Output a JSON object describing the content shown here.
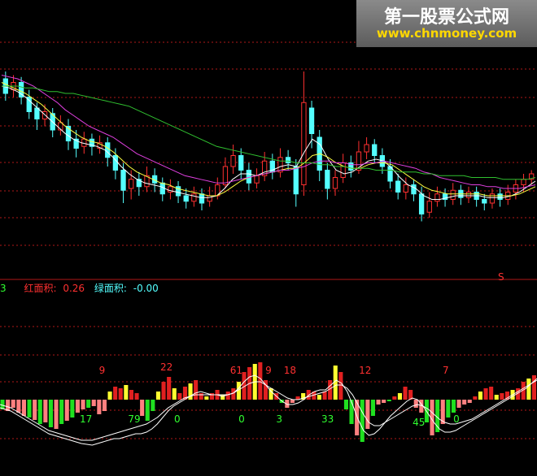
{
  "watermark": {
    "title": "第一股票公式网",
    "url": "www.chnmoney.com"
  },
  "indicator": {
    "prefix": "3",
    "red_label": "红面积:",
    "red_value": "0.26",
    "green_label": "绿面积:",
    "green_value": "-0.00"
  },
  "colors": {
    "background": "#000000",
    "grid": "#b01818",
    "up": "#ff3030",
    "down": "#54ffff",
    "ma_white": "#ffffff",
    "ma_yellow": "#ffff40",
    "ma_magenta": "#e040e0",
    "ma_green": "#30c030",
    "bar_red": "#e02020",
    "bar_yellow": "#ffff30",
    "bar_pink": "#ff8080",
    "bar_green": "#20e020",
    "label_red": "#ff3030",
    "label_green": "#30ff30"
  },
  "chart_data": [
    {
      "type": "candlestick",
      "title": "",
      "xlabel": "",
      "ylabel": "",
      "grid": true,
      "ylim": [
        0,
        100
      ],
      "marker_label": "S",
      "candles": [
        {
          "o": 88,
          "c": 80,
          "h": 92,
          "l": 76
        },
        {
          "o": 82,
          "c": 86,
          "h": 90,
          "l": 78
        },
        {
          "o": 86,
          "c": 78,
          "h": 89,
          "l": 74
        },
        {
          "o": 78,
          "c": 70,
          "h": 82,
          "l": 66
        },
        {
          "o": 72,
          "c": 66,
          "h": 75,
          "l": 60
        },
        {
          "o": 66,
          "c": 70,
          "h": 74,
          "l": 62
        },
        {
          "o": 69,
          "c": 60,
          "h": 72,
          "l": 56
        },
        {
          "o": 60,
          "c": 64,
          "h": 68,
          "l": 57
        },
        {
          "o": 62,
          "c": 54,
          "h": 66,
          "l": 49
        },
        {
          "o": 55,
          "c": 50,
          "h": 60,
          "l": 45
        },
        {
          "o": 51,
          "c": 55,
          "h": 59,
          "l": 47
        },
        {
          "o": 55,
          "c": 51,
          "h": 58,
          "l": 46
        },
        {
          "o": 50,
          "c": 53,
          "h": 57,
          "l": 47
        },
        {
          "o": 53,
          "c": 45,
          "h": 56,
          "l": 40
        },
        {
          "o": 46,
          "c": 38,
          "h": 50,
          "l": 33
        },
        {
          "o": 38,
          "c": 27,
          "h": 42,
          "l": 20
        },
        {
          "o": 28,
          "c": 33,
          "h": 38,
          "l": 22
        },
        {
          "o": 33,
          "c": 29,
          "h": 37,
          "l": 24
        },
        {
          "o": 29,
          "c": 35,
          "h": 40,
          "l": 26
        },
        {
          "o": 35,
          "c": 31,
          "h": 39,
          "l": 26
        },
        {
          "o": 31,
          "c": 25,
          "h": 34,
          "l": 21
        },
        {
          "o": 26,
          "c": 29,
          "h": 33,
          "l": 22
        },
        {
          "o": 29,
          "c": 24,
          "h": 32,
          "l": 20
        },
        {
          "o": 24,
          "c": 21,
          "h": 28,
          "l": 17
        },
        {
          "o": 21,
          "c": 25,
          "h": 29,
          "l": 18
        },
        {
          "o": 25,
          "c": 20,
          "h": 28,
          "l": 16
        },
        {
          "o": 21,
          "c": 24,
          "h": 29,
          "l": 18
        },
        {
          "o": 24,
          "c": 30,
          "h": 34,
          "l": 22
        },
        {
          "o": 30,
          "c": 40,
          "h": 45,
          "l": 28
        },
        {
          "o": 40,
          "c": 46,
          "h": 52,
          "l": 36
        },
        {
          "o": 46,
          "c": 38,
          "h": 50,
          "l": 33
        },
        {
          "o": 38,
          "c": 31,
          "h": 42,
          "l": 27
        },
        {
          "o": 31,
          "c": 35,
          "h": 39,
          "l": 28
        },
        {
          "o": 35,
          "c": 43,
          "h": 48,
          "l": 32
        },
        {
          "o": 43,
          "c": 37,
          "h": 47,
          "l": 33
        },
        {
          "o": 37,
          "c": 45,
          "h": 50,
          "l": 34
        },
        {
          "o": 45,
          "c": 42,
          "h": 49,
          "l": 38
        },
        {
          "o": 40,
          "c": 25,
          "h": 44,
          "l": 18
        },
        {
          "o": 30,
          "c": 75,
          "h": 92,
          "l": 24
        },
        {
          "o": 72,
          "c": 58,
          "h": 76,
          "l": 50
        },
        {
          "o": 56,
          "c": 38,
          "h": 60,
          "l": 32
        },
        {
          "o": 38,
          "c": 28,
          "h": 42,
          "l": 22
        },
        {
          "o": 28,
          "c": 34,
          "h": 38,
          "l": 24
        },
        {
          "o": 34,
          "c": 42,
          "h": 47,
          "l": 31
        },
        {
          "o": 42,
          "c": 38,
          "h": 46,
          "l": 34
        },
        {
          "o": 38,
          "c": 48,
          "h": 54,
          "l": 36
        },
        {
          "o": 48,
          "c": 52,
          "h": 56,
          "l": 44
        },
        {
          "o": 52,
          "c": 46,
          "h": 55,
          "l": 42
        },
        {
          "o": 46,
          "c": 40,
          "h": 50,
          "l": 36
        },
        {
          "o": 40,
          "c": 32,
          "h": 44,
          "l": 28
        },
        {
          "o": 32,
          "c": 26,
          "h": 36,
          "l": 22
        },
        {
          "o": 26,
          "c": 30,
          "h": 34,
          "l": 22
        },
        {
          "o": 30,
          "c": 25,
          "h": 33,
          "l": 21
        },
        {
          "o": 25,
          "c": 14,
          "h": 29,
          "l": 10
        },
        {
          "o": 15,
          "c": 21,
          "h": 26,
          "l": 12
        },
        {
          "o": 21,
          "c": 25,
          "h": 29,
          "l": 18
        },
        {
          "o": 25,
          "c": 22,
          "h": 28,
          "l": 18
        },
        {
          "o": 22,
          "c": 27,
          "h": 31,
          "l": 19
        },
        {
          "o": 27,
          "c": 23,
          "h": 30,
          "l": 19
        },
        {
          "o": 23,
          "c": 26,
          "h": 29,
          "l": 20
        },
        {
          "o": 26,
          "c": 22,
          "h": 29,
          "l": 18
        },
        {
          "o": 22,
          "c": 20,
          "h": 25,
          "l": 16
        },
        {
          "o": 20,
          "c": 25,
          "h": 28,
          "l": 17
        },
        {
          "o": 25,
          "c": 22,
          "h": 28,
          "l": 18
        },
        {
          "o": 22,
          "c": 26,
          "h": 30,
          "l": 19
        },
        {
          "o": 26,
          "c": 30,
          "h": 33,
          "l": 22
        },
        {
          "o": 30,
          "c": 33,
          "h": 36,
          "l": 26
        },
        {
          "o": 33,
          "c": 36,
          "h": 38,
          "l": 30
        }
      ],
      "ma": [
        {
          "color": "white",
          "values": [
            84,
            83,
            81,
            78,
            74,
            70,
            66,
            62,
            58,
            55,
            53,
            52,
            51,
            49,
            45,
            40,
            36,
            33,
            31,
            30,
            29,
            27,
            26,
            25,
            24,
            23,
            23,
            24,
            28,
            33,
            36,
            36,
            35,
            37,
            38,
            40,
            41,
            40,
            48,
            55,
            52,
            44,
            38,
            36,
            37,
            40,
            43,
            44,
            43,
            39,
            34,
            30,
            28,
            24,
            22,
            22,
            23,
            24,
            24,
            24,
            24,
            23,
            23,
            23,
            24,
            26,
            29,
            32
          ]
        },
        {
          "color": "yellow",
          "values": [
            86,
            84,
            82,
            80,
            77,
            74,
            70,
            66,
            62,
            59,
            56,
            54,
            53,
            51,
            48,
            44,
            40,
            37,
            35,
            33,
            31,
            30,
            28,
            27,
            26,
            25,
            24,
            24,
            26,
            29,
            32,
            34,
            35,
            36,
            37,
            38,
            39,
            39,
            42,
            46,
            47,
            45,
            42,
            40,
            39,
            39,
            41,
            42,
            42,
            41,
            38,
            35,
            32,
            29,
            27,
            26,
            25,
            25,
            25,
            25,
            25,
            24,
            24,
            24,
            24,
            25,
            27,
            29
          ]
        },
        {
          "color": "magenta",
          "values": [
            90,
            89,
            88,
            86,
            84,
            81,
            78,
            75,
            71,
            68,
            65,
            62,
            60,
            58,
            56,
            53,
            50,
            47,
            45,
            43,
            41,
            39,
            37,
            35,
            34,
            33,
            32,
            31,
            31,
            32,
            33,
            34,
            35,
            36,
            37,
            38,
            38,
            39,
            40,
            42,
            43,
            43,
            42,
            42,
            41,
            41,
            42,
            42,
            43,
            42,
            41,
            40,
            39,
            37,
            36,
            34,
            33,
            32,
            31,
            30,
            30,
            29,
            29,
            28,
            28,
            28,
            29,
            30
          ]
        },
        {
          "color": "green",
          "values": [
            84,
            84,
            84,
            83,
            83,
            82,
            81,
            81,
            80,
            80,
            79,
            78,
            77,
            76,
            75,
            74,
            73,
            71,
            69,
            67,
            65,
            63,
            61,
            59,
            57,
            55,
            53,
            51,
            50,
            49,
            48,
            47,
            46,
            45,
            44,
            43,
            43,
            42,
            42,
            42,
            41,
            41,
            40,
            40,
            39,
            39,
            39,
            38,
            38,
            38,
            37,
            37,
            37,
            36,
            36,
            35,
            35,
            35,
            35,
            34,
            34,
            34,
            34,
            33,
            33,
            33,
            33,
            34
          ]
        }
      ]
    },
    {
      "type": "bar",
      "title": "",
      "xlabel": "",
      "ylabel": "",
      "grid": true,
      "ylim": [
        -60,
        60
      ],
      "values": [
        -12,
        -14,
        -10,
        -16,
        -20,
        -22,
        -25,
        -30,
        -28,
        -34,
        -36,
        -30,
        -26,
        -22,
        -16,
        -12,
        -10,
        -8,
        -18,
        -14,
        10,
        16,
        14,
        18,
        12,
        8,
        -20,
        -26,
        -14,
        10,
        22,
        28,
        14,
        8,
        16,
        20,
        24,
        8,
        4,
        8,
        12,
        6,
        10,
        14,
        22,
        34,
        40,
        44,
        46,
        24,
        14,
        8,
        -4,
        -10,
        -4,
        4,
        8,
        12,
        10,
        6,
        10,
        24,
        42,
        34,
        -12,
        -30,
        -44,
        -52,
        -36,
        -20,
        -6,
        -4,
        -2,
        4,
        8,
        16,
        12,
        -10,
        -16,
        -28,
        -44,
        -40,
        -30,
        -22,
        -16,
        -10,
        -6,
        -4,
        4,
        10,
        14,
        16,
        6,
        8,
        10,
        12,
        14,
        22,
        26,
        30
      ],
      "overlays": [
        {
          "color": "white",
          "values": [
            -10,
            -12,
            -14,
            -18,
            -22,
            -26,
            -30,
            -34,
            -38,
            -42,
            -44,
            -46,
            -48,
            -50,
            -52,
            -54,
            -55,
            -56,
            -54,
            -52,
            -50,
            -48,
            -48,
            -46,
            -44,
            -42,
            -42,
            -40,
            -36,
            -30,
            -22,
            -14,
            -8,
            -4,
            0,
            4,
            8,
            10,
            8,
            6,
            6,
            4,
            6,
            8,
            14,
            22,
            28,
            30,
            26,
            18,
            10,
            4,
            -2,
            -6,
            -6,
            -4,
            0,
            6,
            10,
            12,
            12,
            18,
            24,
            20,
            10,
            -6,
            -24,
            -38,
            -44,
            -42,
            -36,
            -28,
            -20,
            -14,
            -8,
            -2,
            2,
            0,
            -8,
            -18,
            -28,
            -36,
            -40,
            -40,
            -38,
            -34,
            -30,
            -26,
            -22,
            -18,
            -14,
            -10,
            -6,
            -2,
            2,
            6,
            10,
            14,
            20,
            26
          ]
        },
        {
          "color": "white2",
          "values": [
            -6,
            -8,
            -10,
            -14,
            -18,
            -22,
            -26,
            -30,
            -34,
            -38,
            -40,
            -42,
            -44,
            -46,
            -48,
            -50,
            -50,
            -50,
            -48,
            -46,
            -44,
            -42,
            -40,
            -38,
            -36,
            -34,
            -32,
            -30,
            -26,
            -22,
            -16,
            -10,
            -6,
            -2,
            2,
            4,
            6,
            6,
            6,
            6,
            6,
            6,
            6,
            8,
            12,
            16,
            20,
            22,
            22,
            18,
            14,
            10,
            6,
            2,
            0,
            0,
            2,
            4,
            6,
            8,
            10,
            14,
            18,
            18,
            14,
            6,
            -6,
            -18,
            -28,
            -32,
            -32,
            -28,
            -24,
            -20,
            -16,
            -12,
            -8,
            -6,
            -8,
            -12,
            -18,
            -24,
            -28,
            -30,
            -30,
            -28,
            -26,
            -24,
            -20,
            -16,
            -12,
            -8,
            -4,
            0,
            4,
            8,
            12,
            16,
            20,
            24
          ]
        }
      ],
      "annotations": [
        {
          "text": "9",
          "color": "red",
          "index": 19
        },
        {
          "text": "22",
          "color": "red",
          "index": 31
        },
        {
          "text": "61",
          "color": "red",
          "index": 44
        },
        {
          "text": "18",
          "color": "red",
          "index": 54
        },
        {
          "text": "9",
          "color": "red",
          "index": 50
        },
        {
          "text": "12",
          "color": "red",
          "index": 68
        },
        {
          "text": "7",
          "color": "red",
          "index": 83
        },
        {
          "text": "17",
          "color": "green",
          "index": 16
        },
        {
          "text": "79",
          "color": "green",
          "index": 25
        },
        {
          "text": "0",
          "color": "green",
          "index": 33
        },
        {
          "text": "0",
          "color": "green",
          "index": 45
        },
        {
          "text": "3",
          "color": "green",
          "index": 52
        },
        {
          "text": "33",
          "color": "green",
          "index": 61
        },
        {
          "text": "45",
          "color": "green",
          "index": 78
        },
        {
          "text": "0",
          "color": "green",
          "index": 85
        }
      ]
    }
  ]
}
